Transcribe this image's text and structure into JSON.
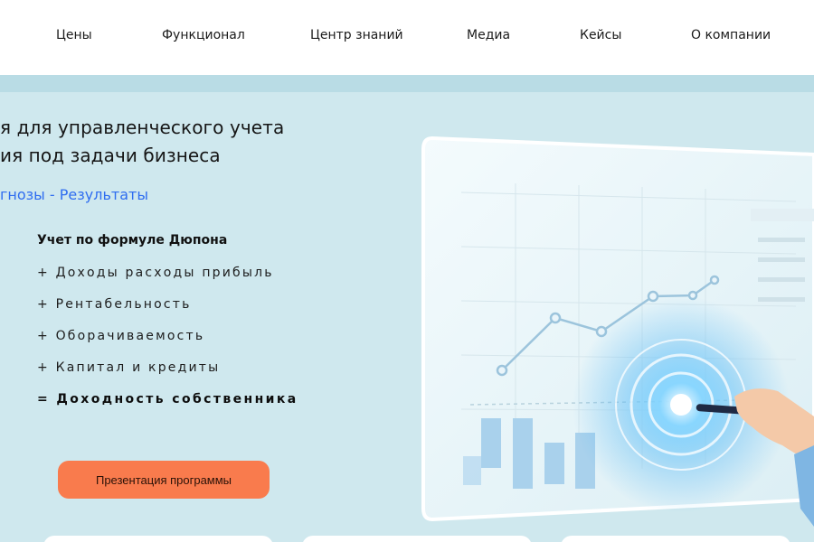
{
  "nav": {
    "items": [
      {
        "label": "Цены"
      },
      {
        "label": "Функционал"
      },
      {
        "label": "Центр знаний"
      },
      {
        "label": "Медиа"
      },
      {
        "label": "Кейсы"
      },
      {
        "label": "О компании"
      }
    ]
  },
  "hero": {
    "headline_line1": "я для управленческого учета",
    "headline_line2": "ия под задачи бизнеса",
    "tagline_part1": "гнозы",
    "tagline_sep": " - ",
    "tagline_part2": "Результаты",
    "formula_title": "Учет по формуле Дюпона",
    "formula_lines": [
      "+ Доходы расходы прибыль",
      "+ Рентабельность",
      "+ Оборачиваемость",
      "+ Капитал и кредиты"
    ],
    "formula_total": "= Доходность собственника",
    "cta_label": "Презентация программы"
  },
  "colors": {
    "hero_bg": "#cfe8ee",
    "accent_blue": "#2f6df0",
    "cta_orange": "#f97b4d"
  },
  "icons": {
    "illustration": "analytics-board-illustration"
  }
}
